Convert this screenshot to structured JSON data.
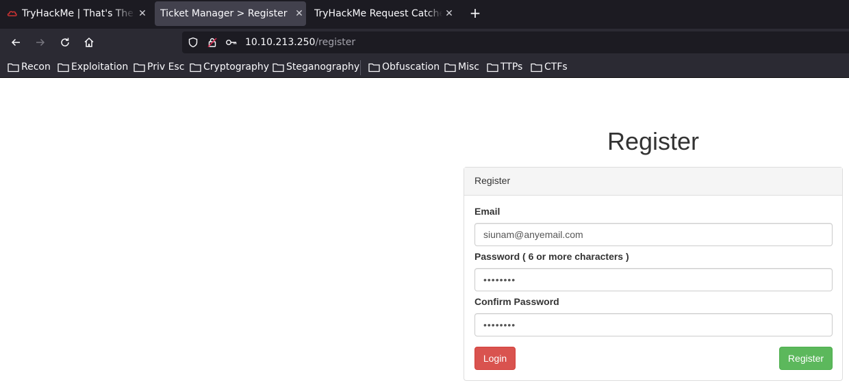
{
  "browser": {
    "tabs": [
      {
        "title": "TryHackMe | That's The Ti",
        "active": false
      },
      {
        "title": "Ticket Manager > Register",
        "active": true
      },
      {
        "title": "TryHackMe Request Catcher",
        "active": false
      }
    ],
    "url_host": "10.10.213.250",
    "url_path": "/register",
    "bookmarks": [
      "Recon",
      "Exploitation",
      "Priv Esc",
      "Cryptography",
      "Steganography",
      "Obfuscation",
      "Misc",
      "TTPs",
      "CTFs"
    ]
  },
  "page": {
    "heading": "Register",
    "panel_title": "Register",
    "email_label": "Email",
    "email_value": "siunam@anyemail.com",
    "password_label": "Password ( 6 or more characters )",
    "password_value": "••••••••",
    "confirm_label": "Confirm Password",
    "confirm_value": "••••••••",
    "login_button": "Login",
    "register_button": "Register"
  },
  "colors": {
    "login": "#d9534f",
    "register": "#5cb85c",
    "tabstrip": "#1c1b22",
    "toolbar": "#2b2a33"
  }
}
